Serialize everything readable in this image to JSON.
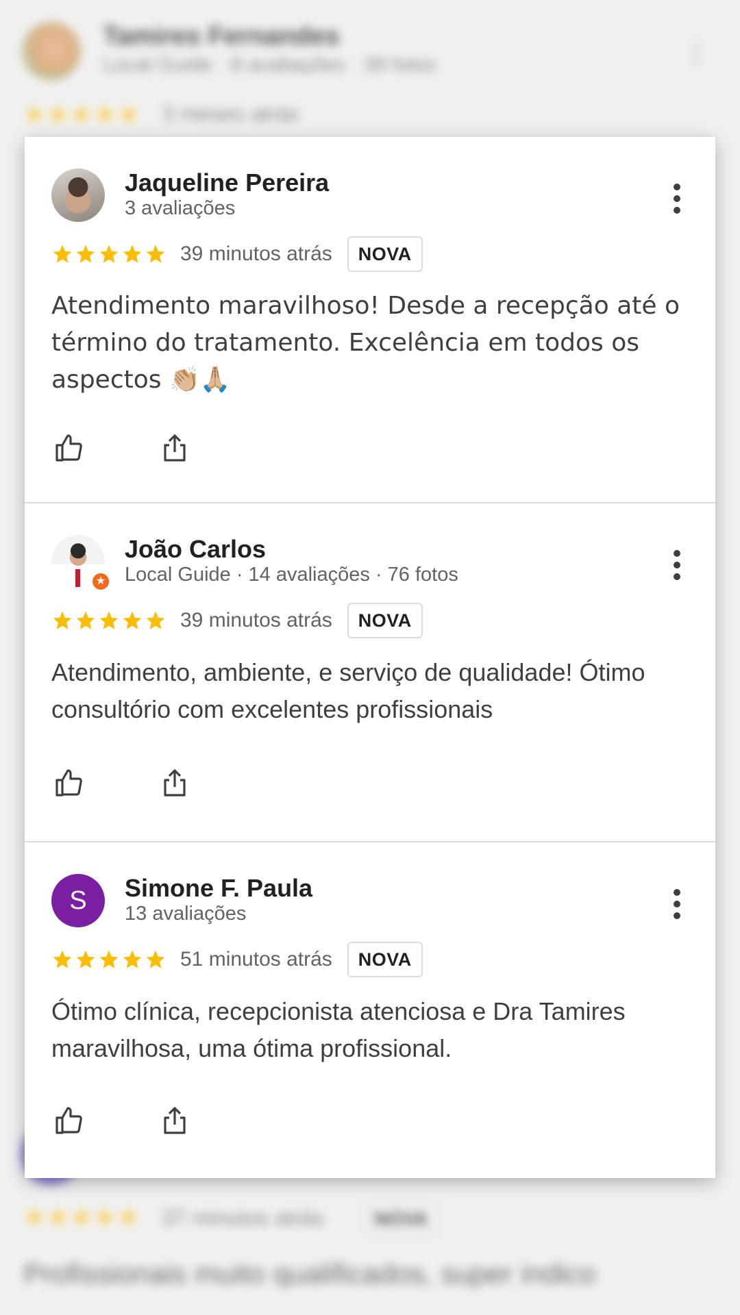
{
  "background": {
    "top_name": "Tamires Fernandes",
    "top_meta": "Local Guide · 8 avaliações · 39 fotos",
    "top_time": "3 meses atrás",
    "bottom_time": "37 minutos atrás",
    "bottom_badge": "NOVA",
    "bottom_text": "Profissionais muito qualificados, super indico"
  },
  "colors": {
    "star": "#fbbc04",
    "avatar_purple": "#7b1fa2",
    "guide_orange": "#f26b1d"
  },
  "reviews": [
    {
      "name": "Jaqueline Pereira",
      "meta": "3 avaliações",
      "rating": 5,
      "time": "39 minutos atrás",
      "badge": "NOVA",
      "text": "Atendimento maravilhoso! Desde a recepção até o término do tratamento. Excelência em todos os aspectos 👏🏼🙏🏼",
      "avatar": "photo",
      "icons": [
        "thumb-up-icon",
        "share-icon",
        "more-vert-icon"
      ]
    },
    {
      "name": "João Carlos",
      "meta": "Local Guide · 14 avaliações · 76 fotos",
      "rating": 5,
      "time": "39 minutos atrás",
      "badge": "NOVA",
      "text": "Atendimento, ambiente, e serviço de qualidade! Ótimo consultório com excelentes profissionais",
      "avatar": "photo",
      "guide_badge": "★",
      "icons": [
        "thumb-up-icon",
        "share-icon",
        "more-vert-icon"
      ]
    },
    {
      "name": "Simone F. Paula",
      "meta": "13 avaliações",
      "rating": 5,
      "time": "51 minutos atrás",
      "badge": "NOVA",
      "text": "Ótimo clínica, recepcionista atenciosa e Dra Tamires maravilhosa, uma ótima profissional.",
      "avatar_letter": "S",
      "icons": [
        "thumb-up-icon",
        "share-icon",
        "more-vert-icon"
      ]
    }
  ]
}
